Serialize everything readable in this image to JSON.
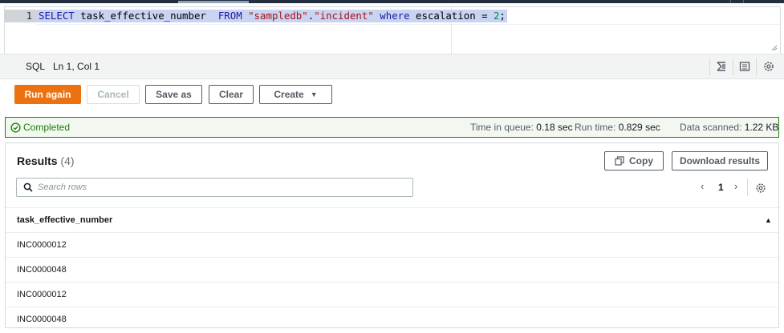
{
  "editor": {
    "line_number": "1",
    "query_tokens": [
      {
        "text": "SELECT",
        "kind": "kw"
      },
      {
        "text": " task_effective_number  ",
        "kind": "id"
      },
      {
        "text": "FROM",
        "kind": "kw"
      },
      {
        "text": " ",
        "kind": "id"
      },
      {
        "text": "\"sampledb\"",
        "kind": "str"
      },
      {
        "text": ".",
        "kind": "id"
      },
      {
        "text": "\"incident\"",
        "kind": "str"
      },
      {
        "text": " ",
        "kind": "id"
      },
      {
        "text": "where",
        "kind": "kw"
      },
      {
        "text": " escalation = ",
        "kind": "id"
      },
      {
        "text": "2",
        "kind": "num"
      },
      {
        "text": ";",
        "kind": "id"
      }
    ]
  },
  "statusbar": {
    "language": "SQL",
    "cursor_position": "Ln 1, Col 1",
    "icons": [
      "format-icon",
      "panel-icon",
      "settings-icon"
    ]
  },
  "toolbar": {
    "run_label": "Run again",
    "cancel_label": "Cancel",
    "save_label": "Save as",
    "clear_label": "Clear",
    "create_label": "Create"
  },
  "status": {
    "state": "Completed",
    "queue_label": "Time in queue:",
    "queue_value": "0.18 sec",
    "runtime_label": "Run time:",
    "runtime_value": "0.829 sec",
    "scanned_label": "Data scanned:",
    "scanned_value": "1.22 KB"
  },
  "results": {
    "title": "Results",
    "count": "(4)",
    "copy_label": "Copy",
    "download_label": "Download results",
    "search_placeholder": "Search rows",
    "page": "1",
    "columns": [
      "task_effective_number"
    ],
    "rows": [
      [
        "INC0000012"
      ],
      [
        "INC0000048"
      ],
      [
        "INC0000012"
      ],
      [
        "INC0000048"
      ]
    ]
  },
  "colors": {
    "primary": "#ec7211",
    "success": "#1d8102",
    "selection": "#c9d3f2"
  }
}
